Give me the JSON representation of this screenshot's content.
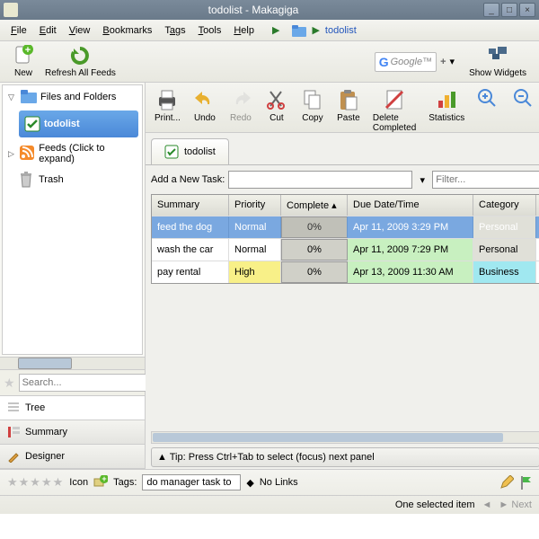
{
  "window": {
    "title": "todolist - Makagiga"
  },
  "menubar": [
    "File",
    "Edit",
    "View",
    "Bookmarks",
    "Tags",
    "Tools",
    "Help"
  ],
  "breadcrumb": "todolist",
  "toolbar1": {
    "new": "New",
    "refresh": "Refresh All Feeds",
    "search_provider": "Google™",
    "show_widgets": "Show Widgets"
  },
  "sidebar": {
    "nodes": {
      "files": "Files and Folders",
      "todolist": "todolist",
      "feeds": "Feeds  (Click to expand)",
      "trash": "Trash"
    },
    "search_placeholder": "Search...",
    "view_tree": "Tree",
    "view_summary": "Summary",
    "view_designer": "Designer"
  },
  "toolbar2": {
    "print": "Print...",
    "undo": "Undo",
    "redo": "Redo",
    "cut": "Cut",
    "copy": "Copy",
    "paste": "Paste",
    "delete_completed": "Delete Completed",
    "statistics": "Statistics"
  },
  "tab": {
    "label": "todolist"
  },
  "addtask": {
    "label": "Add a New Task:",
    "value": "",
    "filter_placeholder": "Filter..."
  },
  "columns": {
    "summary": "Summary",
    "priority": "Priority",
    "complete": "Complete ▴",
    "due": "Due Date/Time",
    "category": "Category"
  },
  "rows": [
    {
      "summary": "feed the dog",
      "priority": "Normal",
      "complete": "0%",
      "due": "Apr 11, 2009 3:29 PM",
      "category": "Personal",
      "selected": true,
      "pri_high": false,
      "due_green": false,
      "cat_cls": "cat-p"
    },
    {
      "summary": "wash the car",
      "priority": "Normal",
      "complete": "0%",
      "due": "Apr 11, 2009 7:29 PM",
      "category": "Personal",
      "selected": false,
      "pri_high": false,
      "due_green": true,
      "cat_cls": "cat-p"
    },
    {
      "summary": "pay rental",
      "priority": "High",
      "complete": "0%",
      "due": "Apr 13, 2009 11:30 AM",
      "category": "Business",
      "selected": false,
      "pri_high": true,
      "due_green": true,
      "cat_cls": "cat-b"
    }
  ],
  "tip": "▲ Tip: Press Ctrl+Tab to select (focus) next panel",
  "bottom": {
    "icon_label": "Icon",
    "tags_label": "Tags:",
    "tags_value": "do manager task to",
    "no_links": "No Links"
  },
  "status": {
    "selected": "One selected item",
    "next": "Next"
  }
}
